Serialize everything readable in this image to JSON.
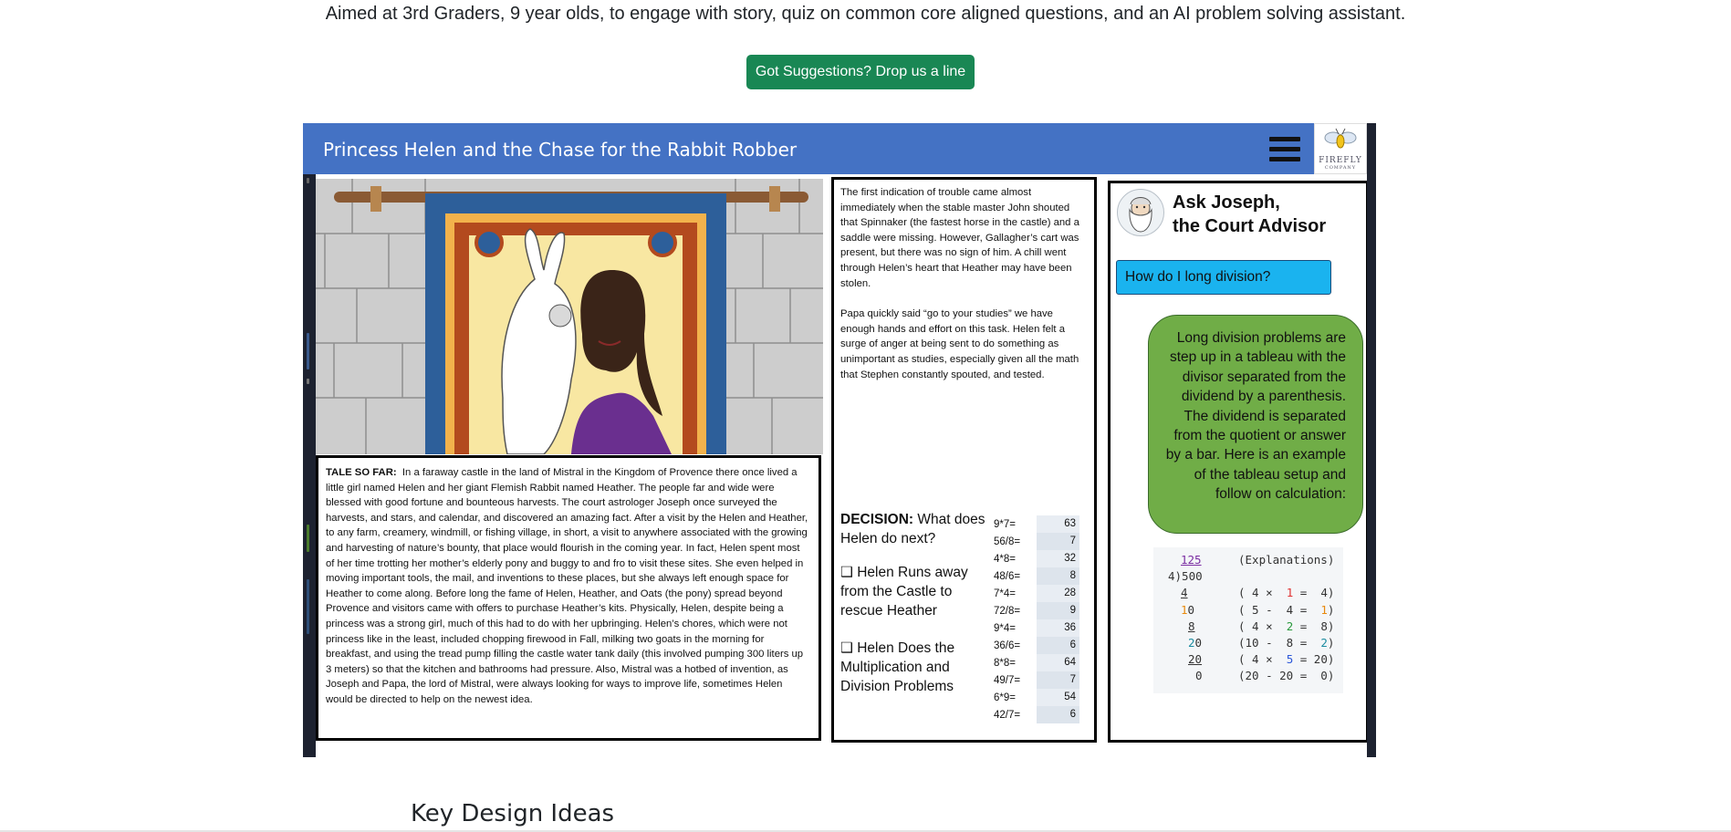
{
  "page": {
    "tagline": "Aimed at 3rd Graders, 9 year olds, to engage with story, quiz on common core aligned questions, and an AI problem solving assistant.",
    "suggest_button": "Got Suggestions? Drop us a line",
    "section_heading": "Key Design Ideas"
  },
  "app": {
    "title": "Princess Helen and the Chase for the Rabbit Robber",
    "logo_text": "FIREFLY",
    "logo_subtext": "COMPANY",
    "story": {
      "label": "TALE SO FAR:",
      "text": "In a faraway castle in the land of Mistral in the Kingdom of Provence there once lived a little girl named Helen and her giant Flemish Rabbit named Heather. The people far and wide were blessed with good fortune and bounteous harvests. The court astrologer Joseph once surveyed the harvests, and stars, and calendar, and discovered an amazing fact. After a visit by the Helen and Heather, to any farm, creamery, windmill, or fishing village, in short, a visit to anywhere associated with the growing and harvesting of nature’s bounty, that place would flourish in the coming year. In fact, Helen spent most of  her time trotting her mother’s elderly pony and buggy to and fro to visit these sites. She even helped in moving important tools, the mail, and inventions to these places, but she always left enough space for Heather to come along. Before long the fame of Helen, Heather, and Oats (the pony) spread beyond Provence and visitors came with offers to purchase Heather’s kits. Physically, Helen, despite being a princess was a strong girl, much of this had to do with her upbringing. Helen’s chores, which were not princess like in the least, included chopping firewood in Fall, milking two goats in the morning for breakfast, and using the tread pump filling the castle water tank daily (this involved pumping 300 liters up 3 meters) so that the kitchen and bathrooms had pressure. Also, Mistral was a hotbed of invention, as Joseph and Papa, the lord of Mistral, were always looking for ways to improve life, sometimes Helen would be directed to help on the newest idea."
    },
    "middle": {
      "para1": "The first indication of trouble came almost immediately when the stable master John shouted that Spinnaker (the fastest horse in the castle) and a saddle were missing. However, Gallagher’s cart was present, but there was no sign of him. A chill went through Helen’s heart that Heather may have been stolen.",
      "para2": "Papa quickly said “go to your studies” we have enough hands and effort on this task. Helen felt a surge of anger at being sent to do something as unimportant as studies, especially given all the math that Stephen constantly spouted, and tested.",
      "decision_label": "DECISION:",
      "decision_question": "What does Helen do next?",
      "option1": "Helen Runs away from the Castle to rescue Heather",
      "option2": " Helen Does the Multiplication and Division Problems",
      "checkbox_glyph": "❑"
    },
    "math_table": [
      {
        "e": "9*7=",
        "a": "63"
      },
      {
        "e": "56/8=",
        "a": "7"
      },
      {
        "e": "4*8=",
        "a": "32"
      },
      {
        "e": "48/6=",
        "a": "8"
      },
      {
        "e": "7*4=",
        "a": "28"
      },
      {
        "e": "72/8=",
        "a": "9"
      },
      {
        "e": "9*4=",
        "a": "36"
      },
      {
        "e": "36/6=",
        "a": "6"
      },
      {
        "e": "8*8=",
        "a": "64"
      },
      {
        "e": "49/7=",
        "a": "7"
      },
      {
        "e": "6*9=",
        "a": "54"
      },
      {
        "e": "42/7=",
        "a": "6"
      }
    ],
    "advisor": {
      "title_line1": "Ask Joseph,",
      "title_line2": "the Court Advisor",
      "question": "How do I long division?",
      "answer": "Long division problems are step up in a tableau with the divisor separated from the dividend by a parenthesis.  The dividend is separated from the quotient or answer by a bar.  Here is an example of the tableau setup and follow on calculation:",
      "tableau_header": "(Explanations)",
      "tableau_quotient": "125",
      "tableau_division": "4)500"
    }
  },
  "colors": {
    "header_blue": "#4472c4",
    "button_green": "#198754",
    "question_blue": "#1ab3ef",
    "answer_green": "#70ad47"
  }
}
